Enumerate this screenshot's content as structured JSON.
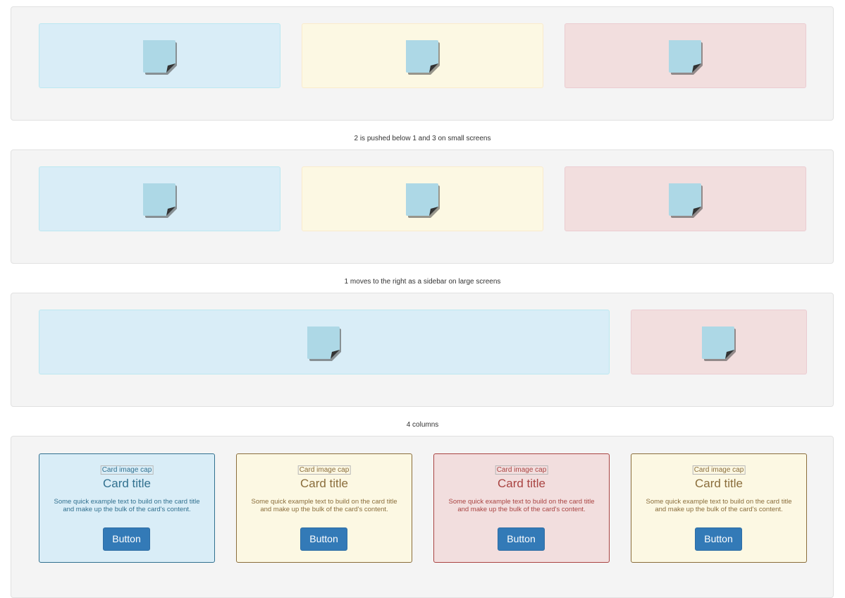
{
  "captions": {
    "c1": "2 is pushed below 1 and 3 on small screens",
    "c2": "1 moves to the right as a sidebar on large screens",
    "c3": "4 columns"
  },
  "icons": {
    "note": "sticky-note-icon"
  },
  "colors": {
    "blue_bg": "#d9edf7",
    "yellow_bg": "#fcf8e3",
    "red_bg": "#f2dede",
    "note_fill": "#add8e6",
    "button": "#337ab7"
  },
  "cards": [
    {
      "cap": "Card image cap",
      "title": "Card title",
      "text": "Some quick example text to build on the card title and make up the bulk of the card's content.",
      "button": "Button"
    },
    {
      "cap": "Card image cap",
      "title": "Card title",
      "text": "Some quick example text to build on the card title and make up the bulk of the card's content.",
      "button": "Button"
    },
    {
      "cap": "Card image cap",
      "title": "Card title",
      "text": "Some quick example text to build on the card title and make up the bulk of the card's content.",
      "button": "Button"
    },
    {
      "cap": "Card image cap",
      "title": "Card title",
      "text": "Some quick example text to build on the card title and make up the bulk of the card's content.",
      "button": "Button"
    }
  ]
}
